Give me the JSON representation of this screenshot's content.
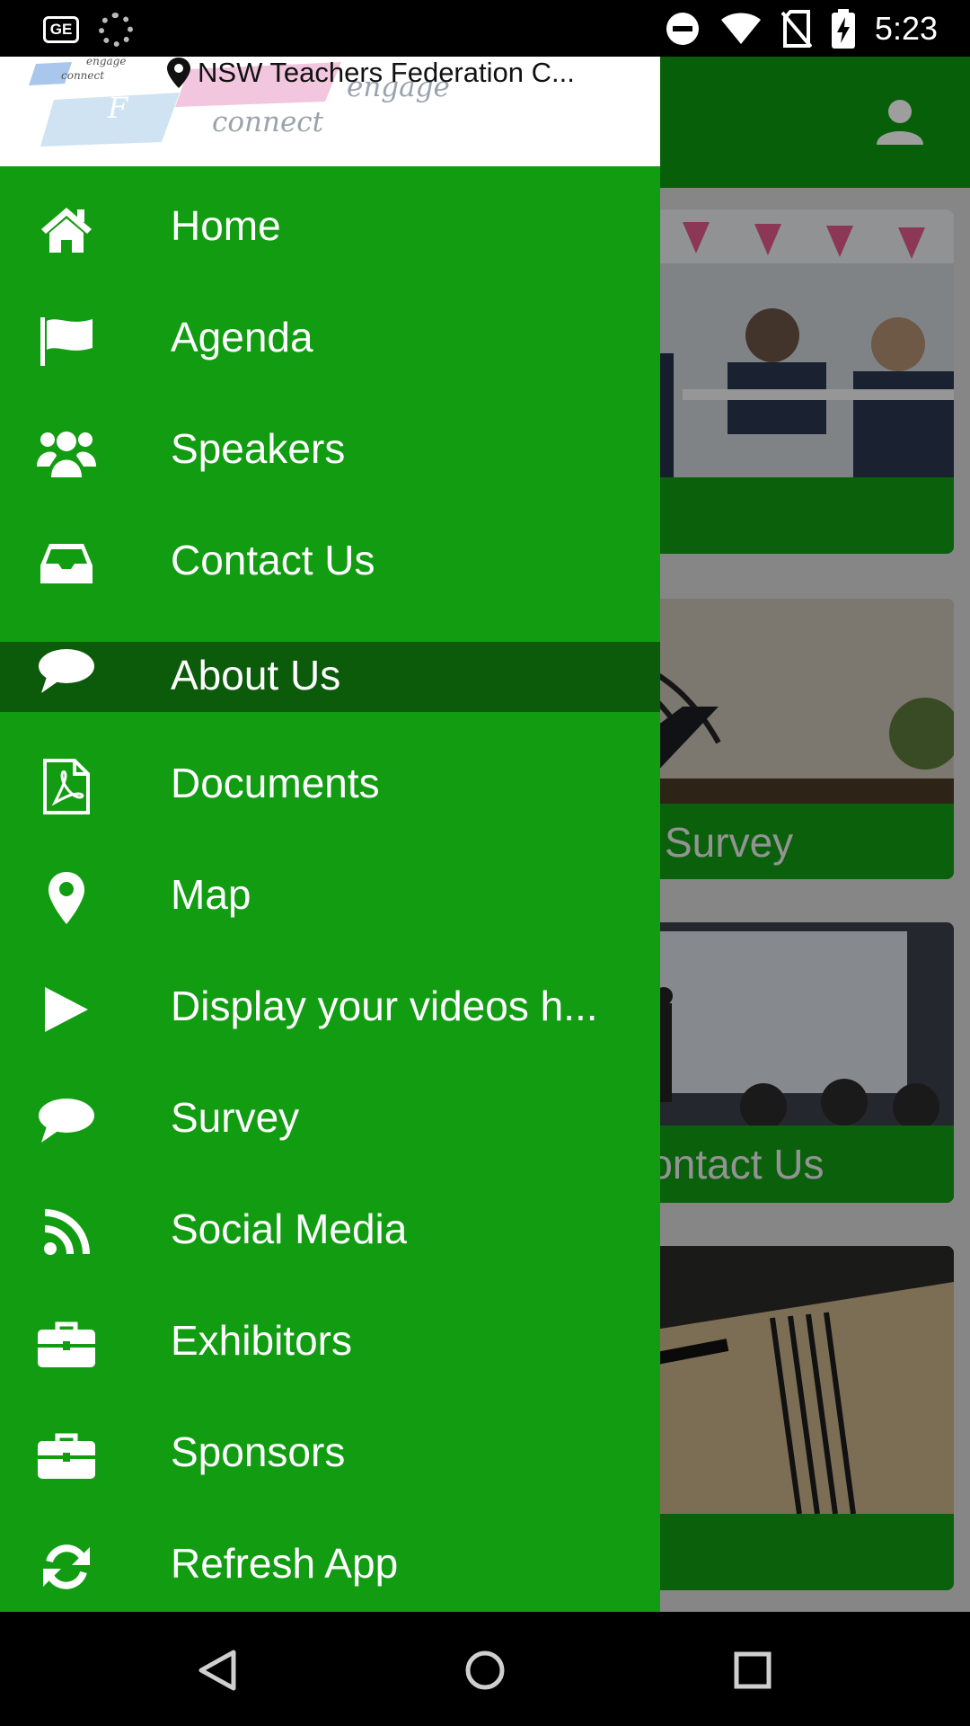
{
  "status_bar": {
    "time": "5:23",
    "left_icons": [
      "ge-badge-icon",
      "loading-spinner-icon"
    ],
    "right_icons": [
      "do-not-disturb-icon",
      "wifi-icon",
      "no-sim-icon",
      "battery-charging-icon"
    ],
    "ge_badge_text": "GE"
  },
  "drawer": {
    "header": {
      "logo_words": [
        "engage",
        "connect"
      ],
      "small_logo_words": [
        "engage",
        "connect"
      ],
      "logo_letter": "F",
      "venue": "NSW Teachers Federation C..."
    },
    "items": [
      {
        "label": "Home",
        "icon": "home-icon"
      },
      {
        "label": "Agenda",
        "icon": "flag-icon"
      },
      {
        "label": "Speakers",
        "icon": "users-icon"
      },
      {
        "label": "Contact Us",
        "icon": "inbox-icon"
      },
      {
        "label": "About Us",
        "icon": "comment-icon",
        "active": true
      },
      {
        "label": "Documents",
        "icon": "pdf-file-icon"
      },
      {
        "label": "Map",
        "icon": "map-marker-icon"
      },
      {
        "label": "Display your videos h...",
        "icon": "play-icon"
      },
      {
        "label": "Survey",
        "icon": "comment-icon"
      },
      {
        "label": "Social Media",
        "icon": "rss-icon"
      },
      {
        "label": "Exhibitors",
        "icon": "briefcase-icon"
      },
      {
        "label": "Sponsors",
        "icon": "briefcase-icon"
      },
      {
        "label": "Refresh App",
        "icon": "refresh-icon"
      }
    ]
  },
  "background": {
    "cards": [
      {
        "label": "",
        "photo": "classroom-students"
      },
      {
        "label": "Survey",
        "photo": "podium-microphones"
      },
      {
        "label": "Contact Us",
        "photo": "presenter-audience"
      },
      {
        "label": "",
        "photo": "notebook-pen"
      }
    ]
  },
  "colors": {
    "primary_green": "#119c12",
    "active_item": "#0b5b0b",
    "status_bar": "#000000"
  },
  "nav_bar": {
    "buttons": [
      "back-icon",
      "home-circle-icon",
      "recents-square-icon"
    ]
  }
}
